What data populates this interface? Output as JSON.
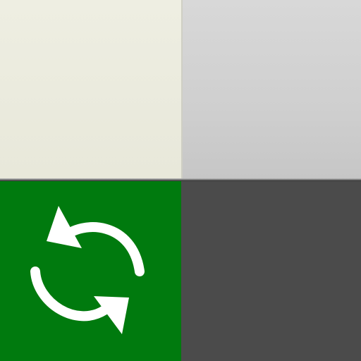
{
  "tiles": {
    "top_left": {
      "color": "#eeeee2"
    },
    "top_right": {
      "color": "#d2d2d2"
    },
    "bottom_left": {
      "color": "#007a0e",
      "icon": "refresh-icon"
    },
    "bottom_right": {
      "color": "#4b4b4b"
    }
  }
}
